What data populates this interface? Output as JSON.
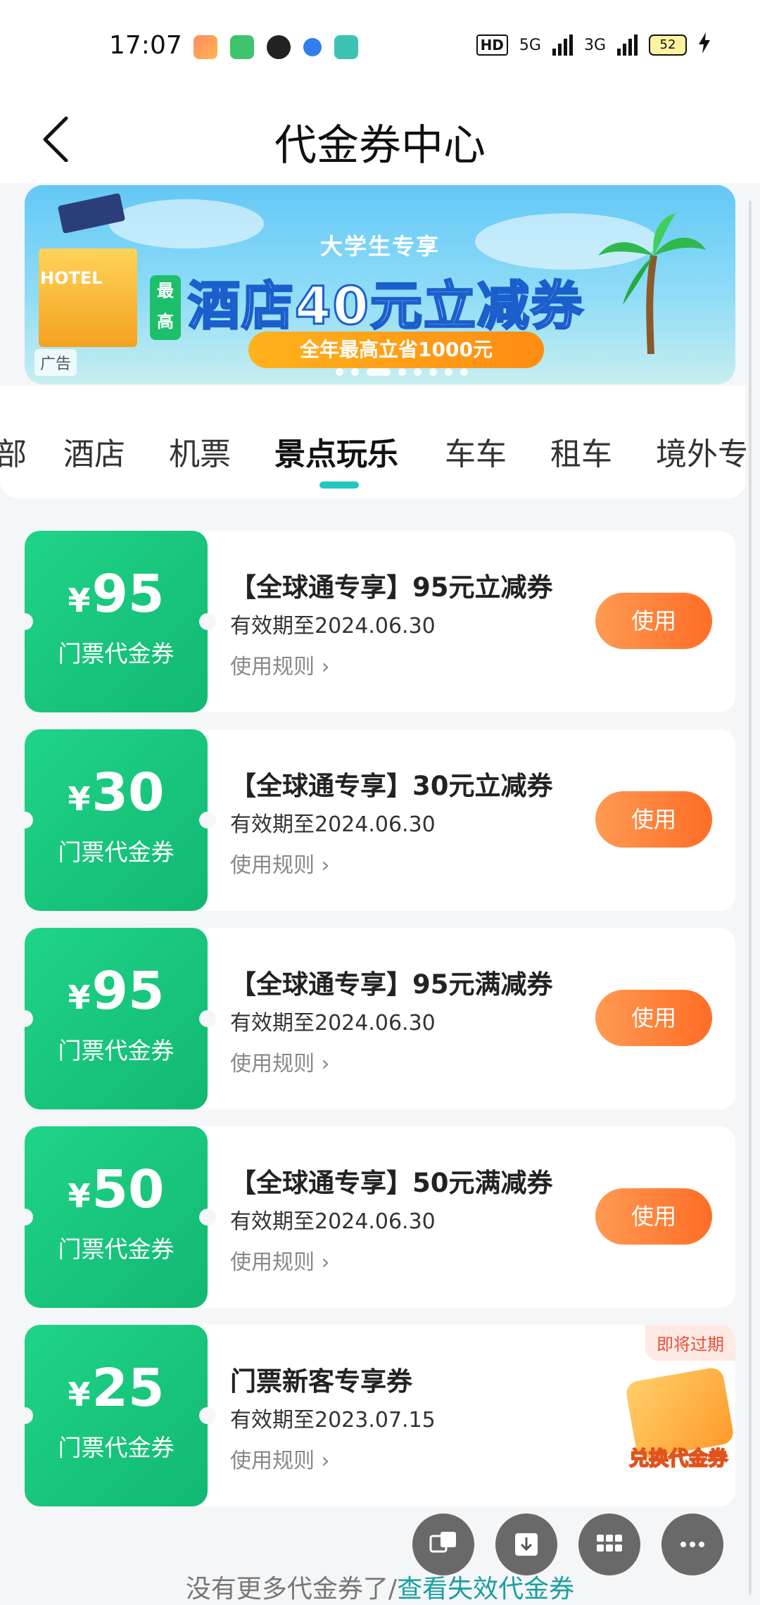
{
  "status_bar": {
    "time": "17:07",
    "hd": "HD",
    "net1": "5G",
    "net2": "3G",
    "battery": "52",
    "app_icons": [
      "game-icon",
      "messages-icon",
      "wechat-icon",
      "browser-icon",
      "music-icon"
    ]
  },
  "header": {
    "title": "代金券中心",
    "back_icon": "chevron-left-icon"
  },
  "banner": {
    "subtitle": "大学生专享",
    "badge": "最高",
    "headline": "酒店40元立减券",
    "strip": "全年最高立省1000元",
    "hotel_label": "HOTEL",
    "ad_label": "广告",
    "slide_count": 8,
    "active_slide": 2
  },
  "tabs": [
    {
      "label": "部"
    },
    {
      "label": "酒店"
    },
    {
      "label": "机票"
    },
    {
      "label": "景点玩乐"
    },
    {
      "label": "车车"
    },
    {
      "label": "租车"
    },
    {
      "label": "境外专享"
    }
  ],
  "active_tab": "景点玩乐",
  "coupons": [
    {
      "currency": "¥",
      "amount": "95",
      "type": "门票代金券",
      "name": "【全球通专享】95元立减券",
      "valid": "有效期至2024.06.30",
      "rule": "使用规则 ›",
      "action": "使用"
    },
    {
      "currency": "¥",
      "amount": "30",
      "type": "门票代金券",
      "name": "【全球通专享】30元立减券",
      "valid": "有效期至2024.06.30",
      "rule": "使用规则 ›",
      "action": "使用"
    },
    {
      "currency": "¥",
      "amount": "95",
      "type": "门票代金券",
      "name": "【全球通专享】95元满减券",
      "valid": "有效期至2024.06.30",
      "rule": "使用规则 ›",
      "action": "使用"
    },
    {
      "currency": "¥",
      "amount": "50",
      "type": "门票代金券",
      "name": "【全球通专享】50元满减券",
      "valid": "有效期至2024.06.30",
      "rule": "使用规则 ›",
      "action": "使用"
    },
    {
      "currency": "¥",
      "amount": "25",
      "type": "门票代金券",
      "name": "门票新客专享券",
      "valid": "有效期至2023.07.15",
      "rule": "使用规则 ›",
      "badge": "即将过期"
    }
  ],
  "exchange_float": {
    "label": "兑换代金券",
    "icon": "coupon-ticket-icon"
  },
  "fab_icons": [
    "translate-icon",
    "download-icon",
    "grid-icon",
    "more-icon"
  ],
  "footer": {
    "text": "没有更多代金券了/",
    "link": "查看失效代金券"
  },
  "colors": {
    "accent_green": "#1fd488",
    "use_button_orange": "#ff6d26",
    "tab_indicator": "#22c8c0",
    "link": "#1a9fa0",
    "expire_badge": "#e5533d"
  }
}
